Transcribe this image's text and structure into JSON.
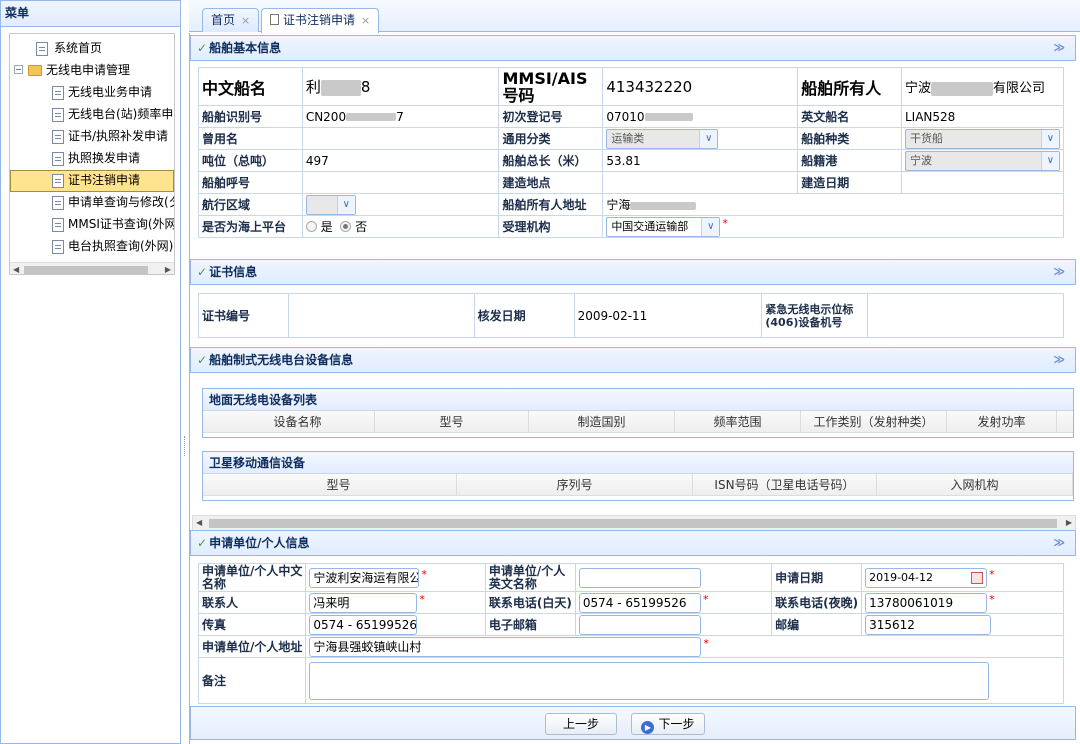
{
  "sidebar": {
    "title": "菜单",
    "items": [
      {
        "label": "系统首页"
      },
      {
        "label": "无线电申请管理"
      },
      {
        "label": "无线电业务申请"
      },
      {
        "label": "无线电台(站)频率申"
      },
      {
        "label": "证书/执照补发申请"
      },
      {
        "label": "执照换发申请"
      },
      {
        "label": "证书注销申请"
      },
      {
        "label": "申请单查询与修改(夕"
      },
      {
        "label": "MMSI证书查询(外网"
      },
      {
        "label": "电台执照查询(外网)"
      }
    ]
  },
  "tabs": [
    {
      "label": "首页",
      "close": "×"
    },
    {
      "label": "证书注销申请",
      "close": "×"
    }
  ],
  "ship": {
    "title": "船舶基本信息",
    "cn_name_label": "中文船名",
    "cn_name_prefix": "利",
    "cn_name_suffix": "8",
    "mmsi_label": "MMSI/AIS号码",
    "mmsi_value": "413432220",
    "owner_label": "船舶所有人",
    "owner_prefix": "宁波",
    "owner_suffix": "有限公司",
    "id_label": "船舶识别号",
    "id_prefix": "CN200",
    "id_suffix": "7",
    "reg_label": "初次登记号",
    "reg_value": "07010",
    "en_name_label": "英文船名",
    "en_name_value": "LIAN528",
    "former_label": "曾用名",
    "former_value": "",
    "category_label": "通用分类",
    "category_value": "运输类",
    "type_label": "船舶种类",
    "type_value": "干货船",
    "tonnage_label": "吨位（总吨）",
    "tonnage_value": "497",
    "length_label": "船舶总长（米）",
    "length_value": "53.81",
    "port_label": "船籍港",
    "port_value": "宁波",
    "callsign_label": "船舶呼号",
    "callsign_value": "",
    "build_place_label": "建造地点",
    "build_place_value": "",
    "build_date_label": "建造日期",
    "build_date_value": "",
    "area_label": "航行区域",
    "area_value": "",
    "owner_addr_label": "船舶所有人地址",
    "owner_addr_prefix": "宁海",
    "offshore_label": "是否为海上平台",
    "yes_label": "是",
    "no_label": "否",
    "authority_label": "受理机构",
    "authority_value": "中国交通运输部"
  },
  "cert": {
    "title": "证书信息",
    "no_label": "证书编号",
    "no_value": "",
    "date_label": "核发日期",
    "date_value": "2009-02-11",
    "epirb_label": "紧急无线电示位标(406)设备机号",
    "epirb_value": ""
  },
  "radio": {
    "title": "船舶制式无线电台设备信息",
    "ground_title": "地面无线电设备列表",
    "ground_cols": [
      "设备名称",
      "型号",
      "制造国别",
      "频率范围",
      "工作类别（发射种类）",
      "发射功率"
    ],
    "sat_title": "卫星移动通信设备",
    "sat_cols": [
      "型号",
      "序列号",
      "ISN号码（卫星电话号码）",
      "入网机构"
    ]
  },
  "applicant": {
    "title": "申请单位/个人信息",
    "cn_name_label": "申请单位/个人中文名称",
    "cn_name_value": "宁波利安海运有限公",
    "en_name_label": "申请单位/个人英文名称",
    "en_name_value": "",
    "date_label": "申请日期",
    "date_value": "2019-04-12",
    "contact_label": "联系人",
    "contact_value": "冯来明",
    "phone_day_label": "联系电话(白天)",
    "phone_day_value": "0574 - 65199526",
    "phone_night_label": "联系电话(夜晚)",
    "phone_night_value": "13780061019",
    "fax_label": "传真",
    "fax_value": "0574 - 65199526",
    "email_label": "电子邮箱",
    "email_value": "",
    "zip_label": "邮编",
    "zip_value": "315612",
    "addr_label": "申请单位/个人地址",
    "addr_value": "宁海县强蛟镇峡山村",
    "note_label": "备注",
    "note_value": "",
    "required_mark": "*"
  },
  "buttons": {
    "prev": "上一步",
    "next": "下一步"
  },
  "icons": {
    "panel_check": "✓",
    "collapse": "≫",
    "dropdown": "▼"
  },
  "colors": {
    "border": "#95b8e7",
    "selected_node": "#ffe48d",
    "required": "#ee0000"
  }
}
